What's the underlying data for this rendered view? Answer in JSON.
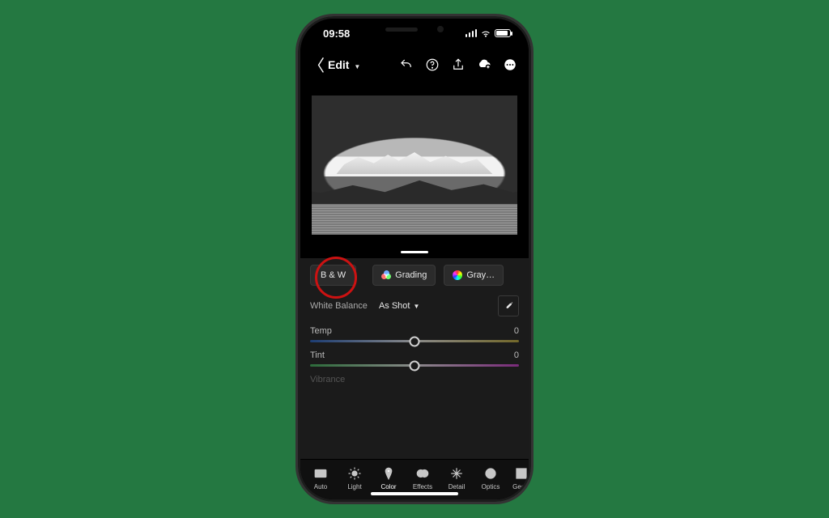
{
  "status": {
    "time": "09:58"
  },
  "header": {
    "edit_label": "Edit"
  },
  "pills": {
    "bw": "B & W",
    "grading": "Grading",
    "gray": "Gray…"
  },
  "wb": {
    "label": "White Balance",
    "value": "As Shot"
  },
  "sliders": {
    "temp": {
      "label": "Temp",
      "value": "0"
    },
    "tint": {
      "label": "Tint",
      "value": "0"
    },
    "vibrance": {
      "label": "Vibrance"
    }
  },
  "tools": {
    "auto": "Auto",
    "light": "Light",
    "color": "Color",
    "effects": "Effects",
    "detail": "Detail",
    "optics": "Optics",
    "geom": "Geom"
  }
}
